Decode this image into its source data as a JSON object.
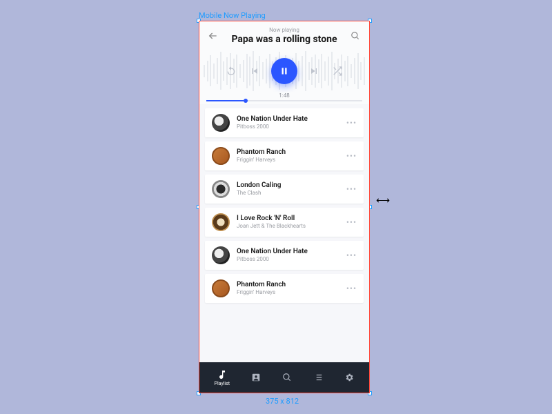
{
  "artboard_label": "Mobile Now Playing",
  "dimensions_label": "375 x 812",
  "header": {
    "overline": "Now playing",
    "title": "Papa was a rolling stone"
  },
  "playback": {
    "elapsed": "1:48",
    "progress_percent": 24
  },
  "tracks": [
    {
      "title": "One Nation Under Hate",
      "artist": "Pitboss 2000",
      "art": "art0"
    },
    {
      "title": "Phantom Ranch",
      "artist": "Friggin' Harveys",
      "art": "art1"
    },
    {
      "title": "London Caling",
      "artist": "The Clash",
      "art": "art2"
    },
    {
      "title": "I Love Rock 'N' Roll",
      "artist": "Joan Jett & The Blackhearts",
      "art": "art3"
    },
    {
      "title": "One Nation Under Hate",
      "artist": "Pitboss 2000",
      "art": "art0"
    },
    {
      "title": "Phantom Ranch",
      "artist": "Friggin' Harveys",
      "art": "art1"
    }
  ],
  "nav": {
    "playlist": "Playlist"
  }
}
